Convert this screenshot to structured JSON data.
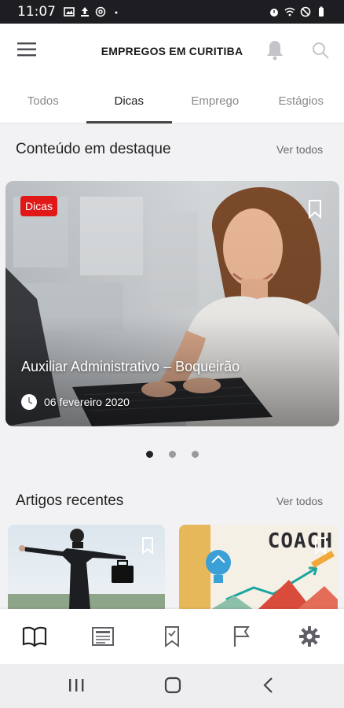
{
  "status_bar": {
    "time": "11:07",
    "left_icons": [
      "image-icon",
      "upload-icon",
      "at-icon",
      "dot-icon"
    ],
    "right_icons": [
      "alarm-icon",
      "wifi-icon",
      "dnd-icon",
      "battery-icon"
    ]
  },
  "app_bar": {
    "title": "EMPREGOS EM CURITIBA",
    "menu_icon": "hamburger-icon",
    "bell_icon": "bell-icon",
    "search_icon": "search-icon"
  },
  "tabs": [
    {
      "label": "Todos",
      "active": false
    },
    {
      "label": "Dicas",
      "active": true
    },
    {
      "label": "Emprego",
      "active": false
    },
    {
      "label": "Estágios",
      "active": false
    }
  ],
  "featured": {
    "section_title": "Conteúdo em destaque",
    "see_all": "Ver todos",
    "card": {
      "badge": "Dicas",
      "title": "Auxiliar Administrativo – Boqueirão",
      "date": "06 fevereiro 2020"
    },
    "carousel_total": 3,
    "carousel_active": 1
  },
  "recent": {
    "section_title": "Artigos recentes",
    "see_all": "Ver todos",
    "coach_label": "COACH"
  },
  "bottom_nav": [
    {
      "icon": "book-open-icon"
    },
    {
      "icon": "newspaper-icon"
    },
    {
      "icon": "bookmark-icon"
    },
    {
      "icon": "flag-icon"
    },
    {
      "icon": "gear-icon"
    }
  ],
  "colors": {
    "badge": "#e01818",
    "accent_dark": "#222222",
    "icon_gray": "#5f5f66"
  }
}
